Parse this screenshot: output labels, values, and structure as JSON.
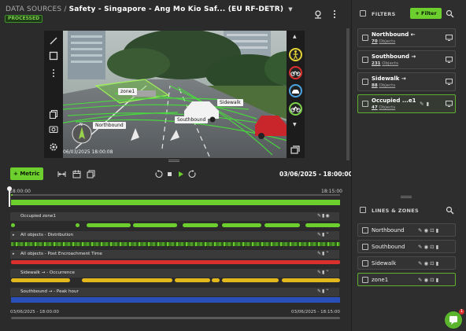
{
  "header": {
    "root": "DATA SOURCES",
    "separator": "/",
    "title": "Safety - Singapore - Ang Mo Kio Saf... (EU RF-DETR)",
    "status": "PROCESSED"
  },
  "video": {
    "timestamp": "06/03/2025 18:00:08",
    "labels": {
      "zone": "zone1",
      "sidewalk": "Sidewalk",
      "northbound": "Northbound",
      "southbound": "Southbound"
    },
    "class_colors": {
      "pedestrian": "#e3d235",
      "motorbike": "#d9302e",
      "car": "#4aa3df",
      "bicycle": "#7ad04a"
    }
  },
  "controls": {
    "metric_label": "Metric",
    "datetime": "03/06/2025 - 18:00:00",
    "playback_progress": 0.005
  },
  "timeline": {
    "start": "18:00:00",
    "end": "18:15:00",
    "footer_start": "03/06/2025 - 18:00:00",
    "footer_end": "03/06/2025 - 18:15:00",
    "rows": [
      {
        "title": "Occupied zone1",
        "color": "#6ccf2e"
      },
      {
        "title": "All objects - Distribution",
        "color": "#6ccf2e"
      },
      {
        "title": "All objects - Post Encroachment Time",
        "color": "#d9302e"
      },
      {
        "title": "Sidewalk → - Occurrence",
        "color": "#e3b81c"
      },
      {
        "title": "Southbound → - Peak hour",
        "color": "#2a4fb8"
      }
    ]
  },
  "filters": {
    "title": "FILTERS",
    "add_label": "Filter",
    "items": [
      {
        "name": "Northbound ←",
        "count": "70",
        "unit": "Objects"
      },
      {
        "name": "Southbound →",
        "count": "231",
        "unit": "Objects"
      },
      {
        "name": "Sidewalk →",
        "count": "88",
        "unit": "Objects"
      },
      {
        "name": "Occupied ...e1",
        "count": "47",
        "unit": "Objects"
      }
    ]
  },
  "zones": {
    "title": "LINES & ZONES",
    "items": [
      {
        "name": "Northbound"
      },
      {
        "name": "Southbound"
      },
      {
        "name": "Sidewalk"
      },
      {
        "name": "zone1"
      }
    ]
  },
  "chat": {
    "badge": "1"
  }
}
